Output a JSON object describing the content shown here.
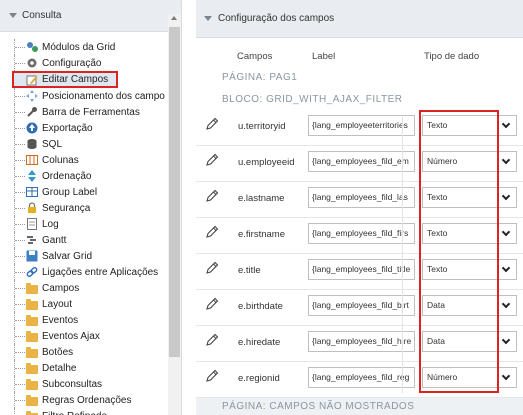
{
  "left_panel": {
    "title": "Consulta",
    "items": [
      {
        "label": "Módulos da Grid",
        "icon": "modules-icon"
      },
      {
        "label": "Configuração",
        "icon": "gear-icon"
      },
      {
        "label": "Editar Campos",
        "icon": "edit-fields-icon",
        "selected": true
      },
      {
        "label": "Posicionamento dos campo",
        "icon": "position-icon"
      },
      {
        "label": "Barra de Ferramentas",
        "icon": "wrench-icon"
      },
      {
        "label": "Exportação",
        "icon": "export-icon"
      },
      {
        "label": "SQL",
        "icon": "database-icon"
      },
      {
        "label": "Colunas",
        "icon": "columns-icon"
      },
      {
        "label": "Ordenação",
        "icon": "sort-icon"
      },
      {
        "label": "Group Label",
        "icon": "table-icon"
      },
      {
        "label": "Segurança",
        "icon": "lock-icon"
      },
      {
        "label": "Log",
        "icon": "log-icon"
      },
      {
        "label": "Gantt",
        "icon": "gantt-icon"
      },
      {
        "label": "Salvar Grid",
        "icon": "save-icon"
      },
      {
        "label": "Ligações entre Aplicações",
        "icon": "link-icon"
      },
      {
        "label": "Campos",
        "icon": "folder-icon"
      },
      {
        "label": "Layout",
        "icon": "folder-icon"
      },
      {
        "label": "Eventos",
        "icon": "folder-icon"
      },
      {
        "label": "Eventos Ajax",
        "icon": "folder-icon"
      },
      {
        "label": "Botões",
        "icon": "folder-icon"
      },
      {
        "label": "Detalhe",
        "icon": "folder-icon"
      },
      {
        "label": "Subconsultas",
        "icon": "folder-icon"
      },
      {
        "label": "Regras Ordenações",
        "icon": "folder-icon"
      },
      {
        "label": "Filtro Refinado",
        "icon": "folder-icon"
      }
    ]
  },
  "right_panel": {
    "title": "Configuração dos campos",
    "columns": {
      "campos": "Campos",
      "label": "Label",
      "tipo": "Tipo de dado"
    },
    "page_label": "PÁGINA: PAG1",
    "block_label": "BLOCO: GRID_WITH_AJAX_FILTER",
    "rows": [
      {
        "field": "u.territoryid",
        "label": "{lang_employeeterritories",
        "type": "Texto"
      },
      {
        "field": "u.employeeid",
        "label": "{lang_employees_fild_em",
        "type": "Número"
      },
      {
        "field": "e.lastname",
        "label": "{lang_employees_fild_las",
        "type": "Texto"
      },
      {
        "field": "e.firstname",
        "label": "{lang_employees_fild_firs",
        "type": "Texto"
      },
      {
        "field": "e.title",
        "label": "{lang_employees_fild_title",
        "type": "Texto"
      },
      {
        "field": "e.birthdate",
        "label": "{lang_employees_fild_birt",
        "type": "Data"
      },
      {
        "field": "e.hiredate",
        "label": "{lang_employees_fild_hire",
        "type": "Data"
      },
      {
        "field": "e.regionid",
        "label": "{lang_employees_fild_reg",
        "type": "Número"
      }
    ],
    "hidden_label": "PÁGINA: CAMPOS NÃO MOSTRADOS"
  },
  "colors": {
    "highlight_border": "#dd2222",
    "panel_header": "#e9edf1",
    "section_text": "#8a96a2"
  }
}
